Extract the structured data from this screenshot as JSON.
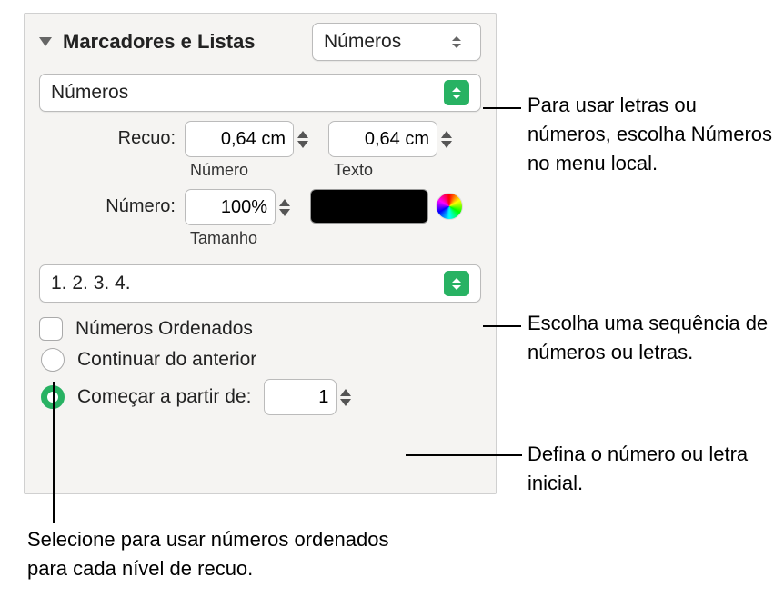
{
  "section": {
    "title": "Marcadores e Listas",
    "style_popup": "Números"
  },
  "bullet_type_popup": "Números",
  "indent": {
    "label": "Recuo:",
    "number_value": "0,64 cm",
    "number_sublabel": "Número",
    "text_value": "0,64 cm",
    "text_sublabel": "Texto"
  },
  "number": {
    "label": "Número:",
    "size_value": "100%",
    "size_sublabel": "Tamanho",
    "color": "#000000"
  },
  "format_popup": "1. 2. 3. 4.",
  "tiered": {
    "label": "Números Ordenados",
    "checked": false
  },
  "radio": {
    "continue_label": "Continuar do anterior",
    "start_label": "Começar a partir de:",
    "start_value": "1",
    "selected": "start"
  },
  "callouts": {
    "c1": "Para usar letras ou números, escolha Números no menu local.",
    "c2": "Escolha uma sequência de números ou letras.",
    "c3": "Defina o número ou letra inicial.",
    "c4": "Selecione para usar números ordenados para cada nível de recuo."
  }
}
